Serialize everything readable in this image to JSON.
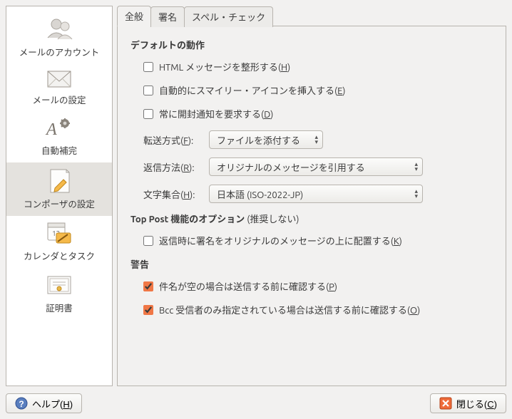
{
  "sidebar": {
    "items": [
      {
        "label": "メールのアカウント"
      },
      {
        "label": "メールの設定"
      },
      {
        "label": "自動補完"
      },
      {
        "label": "コンポーザの設定"
      },
      {
        "label": "カレンダとタスク"
      },
      {
        "label": "証明書"
      }
    ]
  },
  "tabs": {
    "t0": "全般",
    "t1": "署名",
    "t2": "スペル・チェック"
  },
  "sections": {
    "default_behavior": "デフォルトの動作",
    "top_post_caption": " (推奨しない)",
    "top_post": "Top Post 機能のオプション",
    "warnings": "警告"
  },
  "checks": {
    "html_format_pre": "HTML メッセージを整形する(",
    "html_format_u": "H",
    "html_format_post": ")",
    "auto_smiley_pre": "自動的にスマイリー・アイコンを挿入する(",
    "auto_smiley_u": "E",
    "auto_smiley_post": ")",
    "read_receipt_pre": "常に開封通知を要求する(",
    "read_receipt_u": "D",
    "read_receipt_post": ")",
    "sig_top_pre": "返信時に署名をオリジナルのメッセージの上に配置する(",
    "sig_top_u": "K",
    "sig_top_post": ")",
    "warn_subject_pre": "件名が空の場合は送信する前に確認する(",
    "warn_subject_u": "P",
    "warn_subject_post": ")",
    "warn_bcc_pre": "Bcc 受信者のみ指定されている場合は送信する前に確認する(",
    "warn_bcc_u": "O",
    "warn_bcc_post": ")"
  },
  "form": {
    "forward_label_pre": "転送方式(",
    "forward_label_u": "F",
    "forward_label_post": "):",
    "forward_value": "ファイルを添付する",
    "reply_label_pre": "返信方法(",
    "reply_label_u": "R",
    "reply_label_post": "):",
    "reply_value": "オリジナルのメッセージを引用する",
    "charset_label_pre": "文字集合(",
    "charset_label_u": "H",
    "charset_label_post": "):",
    "charset_value": "日本語 (ISO-2022-JP)"
  },
  "footer": {
    "help_pre": "ヘルプ(",
    "help_u": "H",
    "help_post": ")",
    "close_pre": "閉じる(",
    "close_u": "C",
    "close_post": ")"
  }
}
